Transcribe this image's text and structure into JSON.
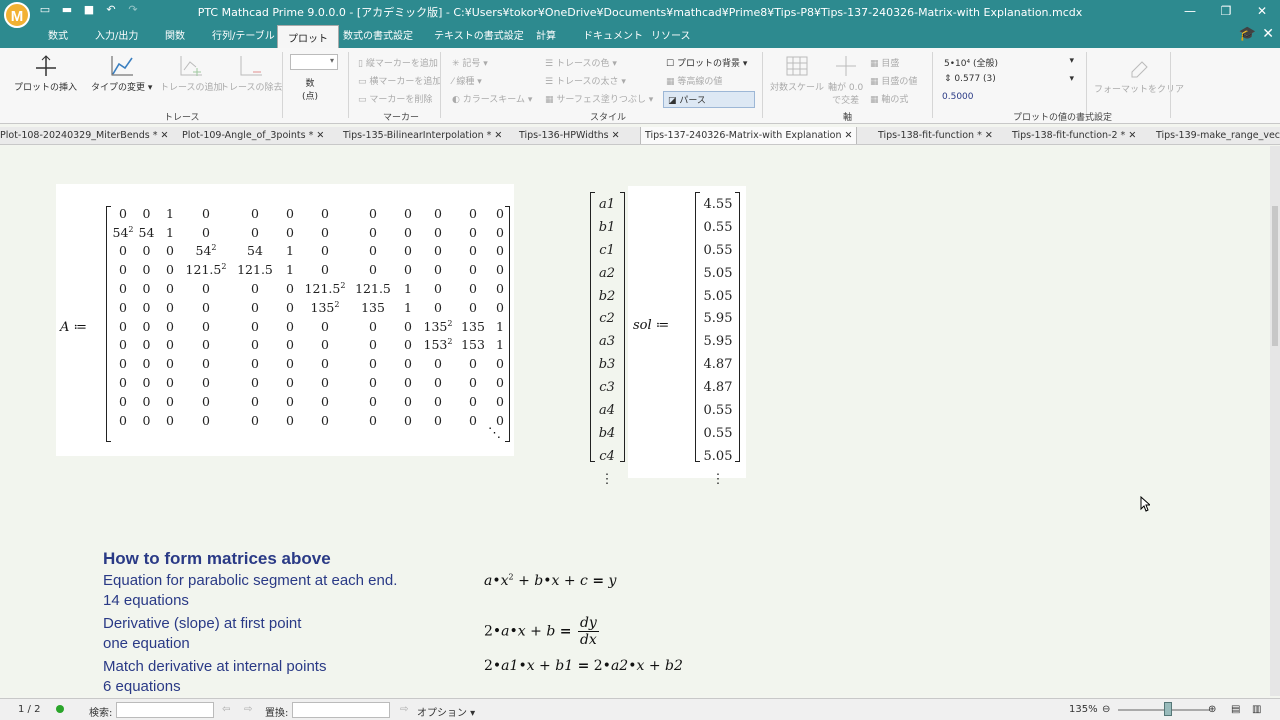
{
  "window": {
    "title": "PTC Mathcad Prime 9.0.0.0 - [アカデミック版] - C:¥Users¥tokor¥OneDrive¥Documents¥mathcad¥Prime8¥Tips-P8¥Tips-137-240326-Matrix-with Explanation.mcdx",
    "logo_letter": "M"
  },
  "ribbon_tabs": [
    "数式",
    "入力/出力",
    "関数",
    "行列/テーブル",
    "プロット",
    "数式の書式設定",
    "テキストの書式設定",
    "計算",
    "ドキュメント",
    "リソース"
  ],
  "ribbon": {
    "trace": {
      "insert_plot": "プロットの挿入",
      "change_type": "タイプの変更",
      "add_trace": "トレースの追加",
      "remove_trace": "トレースの除去",
      "group": "トレース"
    },
    "number": {
      "label1": "数",
      "label2": "(点)"
    },
    "marker": {
      "add_v": "縦マーカーを追加",
      "add_h": "横マーカーを追加",
      "remove": "マーカーを削除",
      "group": "マーカー"
    },
    "style": {
      "symbol": "記号",
      "line": "線種",
      "color_scheme": "カラースキーム",
      "trace_color": "トレースの色",
      "trace_width": "トレースの太さ",
      "surface_fill": "サーフェス塗りつぶし",
      "background": "プロットの背景",
      "contour": "等高線の値",
      "perspective": "パース",
      "group": "スタイル"
    },
    "axis": {
      "log_scale": "対数スケール",
      "cross_zero": "軸が 0.0",
      "cross_zero2": "で交差",
      "grid": "目盛",
      "tick_values": "目盛の値",
      "axis_expr": "軸の式",
      "group": "軸"
    },
    "format": {
      "opt1": "5•10⁴ (全般)",
      "opt2": "0.577 (3)",
      "opt3": "0.5000",
      "clear": "フォーマットをクリア",
      "group": "プロットの値の書式設定"
    }
  },
  "doc_tabs": [
    "Plot-108-20240329_MiterBends *",
    "Plot-109-Angle_of_3points *",
    "Tips-135-BilinearInterpolation *",
    "Tips-136-HPWidths",
    "Tips-137-240326-Matrix-with Explanation",
    "Tips-138-fit-function *",
    "Tips-138-fit-function-2 *",
    "Tips-139-make_range_vec"
  ],
  "matrix_A": {
    "label": "A",
    "rows": [
      [
        "0",
        "0",
        "1",
        "0",
        "0",
        "0",
        "0",
        "0",
        "0",
        "0",
        "0",
        "0"
      ],
      [
        "54²",
        "54",
        "1",
        "0",
        "0",
        "0",
        "0",
        "0",
        "0",
        "0",
        "0",
        "0"
      ],
      [
        "0",
        "0",
        "0",
        "54²",
        "54",
        "1",
        "0",
        "0",
        "0",
        "0",
        "0",
        "0"
      ],
      [
        "0",
        "0",
        "0",
        "121.5²",
        "121.5",
        "1",
        "0",
        "0",
        "0",
        "0",
        "0",
        "0"
      ],
      [
        "0",
        "0",
        "0",
        "0",
        "0",
        "0",
        "121.5²",
        "121.5",
        "1",
        "0",
        "0",
        "0"
      ],
      [
        "0",
        "0",
        "0",
        "0",
        "0",
        "0",
        "135²",
        "135",
        "1",
        "0",
        "0",
        "0"
      ],
      [
        "0",
        "0",
        "0",
        "0",
        "0",
        "0",
        "0",
        "0",
        "0",
        "135²",
        "135",
        "1"
      ],
      [
        "0",
        "0",
        "0",
        "0",
        "0",
        "0",
        "0",
        "0",
        "0",
        "153²",
        "153",
        "1"
      ],
      [
        "0",
        "0",
        "0",
        "0",
        "0",
        "0",
        "0",
        "0",
        "0",
        "0",
        "0",
        "0"
      ],
      [
        "0",
        "0",
        "0",
        "0",
        "0",
        "0",
        "0",
        "0",
        "0",
        "0",
        "0",
        "0"
      ],
      [
        "0",
        "0",
        "0",
        "0",
        "0",
        "0",
        "0",
        "0",
        "0",
        "0",
        "0",
        "0"
      ],
      [
        "0",
        "0",
        "0",
        "0",
        "0",
        "0",
        "0",
        "0",
        "0",
        "0",
        "0",
        "0"
      ]
    ],
    "ellipsis": "⋱"
  },
  "vector_names": [
    "a1",
    "b1",
    "c1",
    "a2",
    "b2",
    "c2",
    "a3",
    "b3",
    "c3",
    "a4",
    "b4",
    "c4",
    "⋮"
  ],
  "sol": {
    "label": "sol",
    "values": [
      "4.55",
      "0.55",
      "0.55",
      "5.05",
      "5.05",
      "5.95",
      "5.95",
      "4.87",
      "4.87",
      "0.55",
      "0.55",
      "5.05",
      "⋮"
    ]
  },
  "assign": "≔",
  "explanation": {
    "heading": "How to form matrices above",
    "lines": [
      {
        "text": "Equation for parabolic segment at each end.",
        "sub": "14 equations"
      },
      {
        "text": "Derivative (slope) at first point",
        "sub": "one equation"
      },
      {
        "text": "Match derivative at internal points",
        "sub": "6 equations"
      }
    ]
  },
  "status": {
    "page": "1 / 2",
    "search_label": "検索:",
    "replace_label": "置換:",
    "options": "オプション",
    "zoom": "135%"
  }
}
